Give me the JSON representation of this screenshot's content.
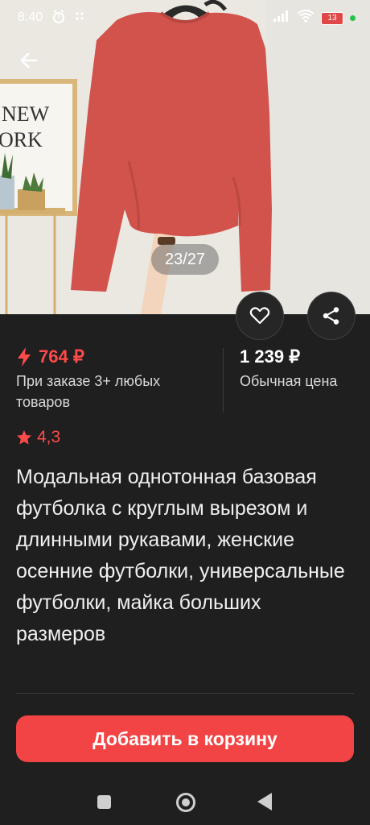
{
  "status_bar": {
    "time": "8:40",
    "battery": "13"
  },
  "gallery": {
    "counter": "23/27",
    "poster_text": "NEW\nYORK"
  },
  "price": {
    "sale_price": "764 ₽",
    "sale_note": "При заказе 3+ любых товаров",
    "regular_price": "1 239 ₽",
    "regular_note": "Обычная цена"
  },
  "rating": {
    "value": "4,3"
  },
  "product": {
    "title": "Модальная однотонная базовая футболка с круглым вырезом и длинными рукавами, женские осенние футболки, универсальные футболки, майка больших размеров"
  },
  "actions": {
    "add_to_cart": "Добавить в корзину"
  },
  "colors": {
    "accent": "#f24444",
    "price_red": "#ff4a4a",
    "background": "#1f1f1f",
    "shirt": "#d2524c"
  },
  "icons": [
    "back-arrow-icon",
    "heart-icon",
    "share-icon",
    "lightning-icon",
    "star-icon",
    "alarm-icon",
    "signal-icon",
    "wifi-icon",
    "battery-icon"
  ]
}
